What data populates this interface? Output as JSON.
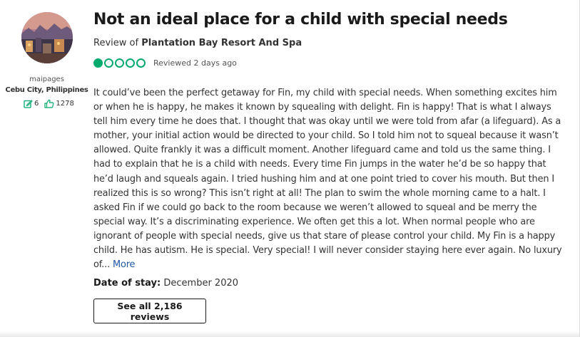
{
  "author": {
    "username": "maipages",
    "location": "Cebu City, Philippines",
    "contributions": "6",
    "helpful_votes": "1278",
    "icons": {
      "avatar": "avatar-photo",
      "contributions": "edit-icon",
      "helpful": "thumbs-up-icon"
    }
  },
  "review": {
    "title": "Not an ideal place for a child with special needs",
    "review_of_prefix": "Review of",
    "hotel_name": "Plantation Bay Resort And Spa",
    "rating": 1,
    "rating_max": 5,
    "reviewed_date": "Reviewed 2 days ago",
    "body": "It could’ve been the perfect getaway for Fin, my child with special needs. When something excites him or when he is happy, he makes it known by squealing with delight. Fin is happy! That is what I always tell him every time he does that. I thought that was okay until we were told from afar (a lifeguard). As a mother, your initial action would be directed to your child. So I told him not to squeal because it wasn’t allowed. Quite frankly it was a difficult moment. Another lifeguard came and told us the same thing. I had to explain that he is a child with needs. Every time Fin jumps in the water he’d be so happy that he’d laugh and squeals again. I tried hushing him and at one point tried to cover his mouth. But then I realized this is so wrong? This isn’t right at all! The plan to swim the whole morning came to a halt. I asked Fin if we could go back to the room because we weren’t allowed to squeal and be merry the special way. It’s a discriminating experience. We often get this a lot. When normal people who are ignorant of people with special needs, give us that stare of please control your child. My Fin is a happy child. He has autism. He is special. Very special! I will never consider staying here ever again. No luxury of...",
    "more_label": "More",
    "date_of_stay_label": "Date of stay:",
    "date_of_stay_value": "December 2020",
    "see_all_label": "See all 2,186 reviews"
  },
  "colors": {
    "rating_green": "#00aa6c",
    "link_blue": "#1c57a5",
    "text_dark": "#1a1a1a"
  }
}
